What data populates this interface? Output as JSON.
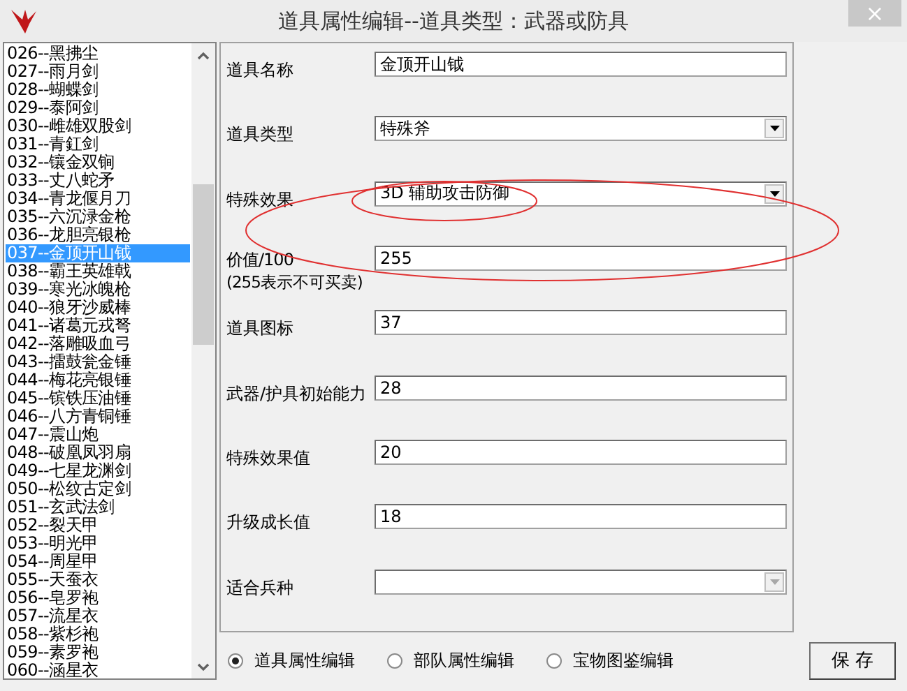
{
  "window": {
    "title": "道具属性编辑--道具类型：武器或防具",
    "close": "×"
  },
  "item_list": {
    "items": [
      {
        "label": "026--黑拂尘",
        "selected": false
      },
      {
        "label": "027--雨月剑",
        "selected": false
      },
      {
        "label": "028--蝴蝶剑",
        "selected": false
      },
      {
        "label": "029--泰阿剑",
        "selected": false
      },
      {
        "label": "030--雌雄双股剑",
        "selected": false
      },
      {
        "label": "031--青釭剑",
        "selected": false
      },
      {
        "label": "032--镶金双锏",
        "selected": false
      },
      {
        "label": "033--丈八蛇矛",
        "selected": false
      },
      {
        "label": "034--青龙偃月刀",
        "selected": false
      },
      {
        "label": "035--六沉渌金枪",
        "selected": false
      },
      {
        "label": "036--龙胆亮银枪",
        "selected": false
      },
      {
        "label": "037--金顶开山钺",
        "selected": true
      },
      {
        "label": "038--霸王英雄戟",
        "selected": false
      },
      {
        "label": "039--寒光冰魄枪",
        "selected": false
      },
      {
        "label": "040--狼牙沙威棒",
        "selected": false
      },
      {
        "label": "041--诸葛元戎弩",
        "selected": false
      },
      {
        "label": "042--落雕吸血弓",
        "selected": false
      },
      {
        "label": "043--擂鼓瓮金锤",
        "selected": false
      },
      {
        "label": "044--梅花亮银锤",
        "selected": false
      },
      {
        "label": "045--镔铁压油锤",
        "selected": false
      },
      {
        "label": "046--八方青铜锤",
        "selected": false
      },
      {
        "label": "047--震山炮",
        "selected": false
      },
      {
        "label": "048--破凰凤羽扇",
        "selected": false
      },
      {
        "label": "049--七星龙渊剑",
        "selected": false
      },
      {
        "label": "050--松纹古定剑",
        "selected": false
      },
      {
        "label": "051--玄武法剑",
        "selected": false
      },
      {
        "label": "052--裂天甲",
        "selected": false
      },
      {
        "label": "053--明光甲",
        "selected": false
      },
      {
        "label": "054--周星甲",
        "selected": false
      },
      {
        "label": "055--天蚕衣",
        "selected": false
      },
      {
        "label": "056--皂罗袍",
        "selected": false
      },
      {
        "label": "057--流星衣",
        "selected": false
      },
      {
        "label": "058--紫杉袍",
        "selected": false
      },
      {
        "label": "059--素罗袍",
        "selected": false
      },
      {
        "label": "060--涵星衣",
        "selected": false
      }
    ]
  },
  "form": {
    "fields": [
      {
        "kind": "text",
        "label": "道具名称",
        "value": "金顶开山钺"
      },
      {
        "kind": "select",
        "label": "道具类型",
        "value": "特殊斧",
        "disabled": false
      },
      {
        "kind": "select",
        "label": "特殊效果",
        "value": "3D 辅助攻击防御",
        "disabled": false
      },
      {
        "kind": "text",
        "label": "价值/100",
        "note": "(255表示不可买卖)",
        "value": "255"
      },
      {
        "kind": "text",
        "label": "道具图标",
        "value": "37"
      },
      {
        "kind": "text",
        "label": "武器/护具初始能力",
        "value": "28"
      },
      {
        "kind": "text",
        "label": "特殊效果值",
        "value": "20"
      },
      {
        "kind": "text",
        "label": "升级成长值",
        "value": "18"
      },
      {
        "kind": "select",
        "label": "适合兵种",
        "disabled": true
      }
    ]
  },
  "modes": [
    {
      "label": "道具属性编辑",
      "selected": true
    },
    {
      "label": "部队属性编辑",
      "selected": false
    },
    {
      "label": "宝物图鉴编辑",
      "selected": false
    }
  ],
  "save_button": "保 存"
}
